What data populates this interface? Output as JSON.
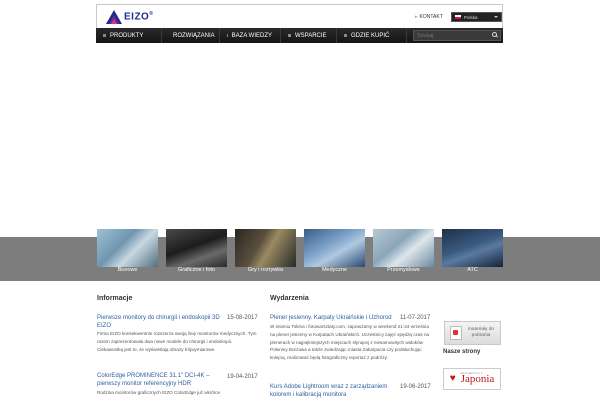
{
  "header": {
    "logo_text": "EIZO",
    "logo_reg": "®",
    "contact_label": "KONTAKT",
    "language": "Polska"
  },
  "nav": {
    "items": [
      {
        "label": "PRODUKTY"
      },
      {
        "label": "ROZWIĄZANIA"
      },
      {
        "label": "BAZA WIEDZY"
      },
      {
        "label": "WSPARCIE"
      },
      {
        "label": "GDZIE KUPIĆ"
      }
    ],
    "search_placeholder": "Szukaj"
  },
  "categories": [
    {
      "label": "Biurowe"
    },
    {
      "label": "Graficzne i foto"
    },
    {
      "label": "Gry i rozrywka"
    },
    {
      "label": "Medyczne"
    },
    {
      "label": "Przemysłowe"
    },
    {
      "label": "ATC"
    }
  ],
  "informacje": {
    "title": "Informacje",
    "items": [
      {
        "title": "Pierwsze monitory do chirurgii i endoskopii 3D EIZO",
        "date": "15-08-2017",
        "text": "Firma EIZO konsekwentnie rozszerza swoją linię monitorów medycznych. Tym razem zaprezentowała dwa nowe modele do chirurgii i endoskopii. Ciekawostką jest to, że wyświetlają obrazy trójwymiarowe."
      },
      {
        "title": "ColorEdge PROMINENCE 31.1\" DCI-4K – pierwszy monitor referencyjny HDR",
        "date": "19-04-2017",
        "text": "Rodzina monitorów graficznych EIZO ColorEdge już wkrótce"
      }
    ]
  },
  "wydarzenia": {
    "title": "Wydarzenia",
    "items": [
      {
        "title": "Plener jesienny. Karpaty Ukraińskie i Uzhorod",
        "date": "11-07-2017",
        "text": "W imieniu Tokina i fotowarsztaty.com, zapraszamy w weekend 21-24 września na plener jesienny w Karpatach Ukraińskich. Uczestnicy zajęć spędzą czas na plenerach w najpiękniejszych miejscach słynącej z niesamowitych widoków Połoniny Borżawa a także zwiedzając miasta Zakarpacia czy podsłuchując kolejną, realizować będą fotograficzny reportaż z podróży."
      },
      {
        "title": "Kurs Adobe Lightroom wraz z zarządzaniem kolorem i kalibracją monitora",
        "date": "19-06-2017",
        "text": ""
      }
    ]
  },
  "sidebar": {
    "materials_label": "materiały do pobrania",
    "partner_title": "Nasze strony",
    "partner_small": "zaprzyjaźniony z",
    "partner_name": "Japonia"
  },
  "colors": {
    "nav_bg": "#1c1c1c",
    "link": "#3060a0",
    "band": "#7d7d7d",
    "brand": "#1d2b8c",
    "accent": "#c0161b"
  }
}
